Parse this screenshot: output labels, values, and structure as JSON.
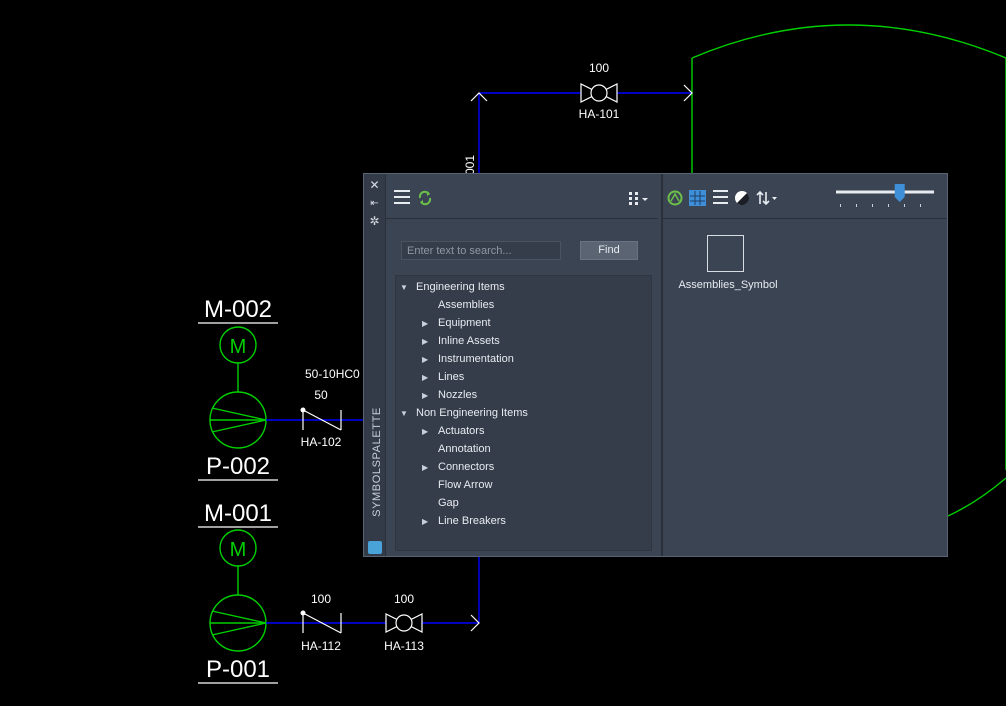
{
  "drawing": {
    "labels": {
      "m002": "M-002",
      "p002": "P-002",
      "m001": "M-001",
      "p001": "P-001",
      "motor_symbol": "M",
      "ha101": "HA-101",
      "ha101_size": "100",
      "ha102": "HA-102",
      "ha102_size": "50",
      "ha112": "HA-112",
      "ha112_size": "100",
      "ha113": "HA-113",
      "ha113_size": "100",
      "line_tag": "50-10HC0",
      "vertical_tag": "001"
    },
    "colors": {
      "background": "#000000",
      "pipe": "#0000ff",
      "equipment": "#00d000",
      "text": "#ffffff"
    }
  },
  "palette": {
    "title": "SYMBOLSPALETTE",
    "strip_icons": [
      "close-icon",
      "auto-hide-icon",
      "properties-icon"
    ],
    "search": {
      "placeholder": "Enter text to search...",
      "find_label": "Find"
    },
    "tree": [
      {
        "label": "Engineering Items",
        "level": 0,
        "expanded": true,
        "has_children": true
      },
      {
        "label": "Assemblies",
        "level": 1,
        "has_children": false
      },
      {
        "label": "Equipment",
        "level": 1,
        "has_children": true
      },
      {
        "label": "Inline Assets",
        "level": 1,
        "has_children": true
      },
      {
        "label": "Instrumentation",
        "level": 1,
        "has_children": true
      },
      {
        "label": "Lines",
        "level": 1,
        "has_children": true
      },
      {
        "label": "Nozzles",
        "level": 1,
        "has_children": true
      },
      {
        "label": "Non Engineering Items",
        "level": 0,
        "expanded": true,
        "has_children": true
      },
      {
        "label": "Actuators",
        "level": 1,
        "has_children": true
      },
      {
        "label": "Annotation",
        "level": 1,
        "has_children": false
      },
      {
        "label": "Connectors",
        "level": 1,
        "has_children": true
      },
      {
        "label": "Flow Arrow",
        "level": 1,
        "has_children": false
      },
      {
        "label": "Gap",
        "level": 1,
        "has_children": false
      },
      {
        "label": "Line Breakers",
        "level": 1,
        "has_children": true
      }
    ],
    "symbol": {
      "label": "Assemblies_Symbol"
    },
    "slider": {
      "value": 0.65
    },
    "colors": {
      "panel": "#3b4453",
      "accent": "#3f8fd8",
      "refresh": "#6cc04a"
    }
  }
}
